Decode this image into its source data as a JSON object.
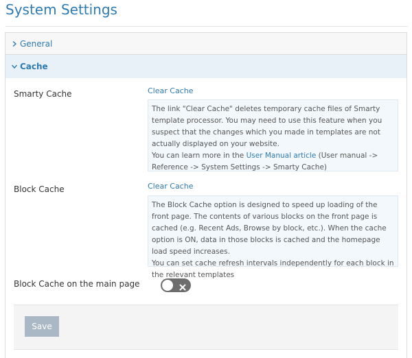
{
  "page": {
    "title": "System Settings"
  },
  "sections": {
    "general": {
      "label": "General"
    },
    "cache": {
      "label": "Cache"
    }
  },
  "smarty": {
    "label": "Smarty Cache",
    "link": "Clear Cache",
    "note_part1": "The link \"Clear Cache\" deletes temporary cache files of Smarty template processor. You may need to use this feature when you suspect that the changes which you made in templates are not actually displayed on your website.",
    "note_part2_prefix": "You can learn more in the",
    "note_link": "User Manual article",
    "note_part2_suffix": "(User manual -> Reference -> System Settings -> Smarty Cache)"
  },
  "block": {
    "label": "Block Cache",
    "link": "Clear Cache",
    "note_part1": "The Block Cache option is designed to speed up loading of the front page. The contents of various blocks on the front page is cached (e.g. Recent Ads, Browse by block, etc.). When the cache option is ON, data in those blocks is cached and the homepage load speed increases.",
    "note_part2": "You can set cache refresh intervals independently for each block in the relevant templates"
  },
  "main_page": {
    "label": "Block Cache on the main page",
    "toggle_state": "off"
  },
  "actions": {
    "save_label": "Save"
  }
}
